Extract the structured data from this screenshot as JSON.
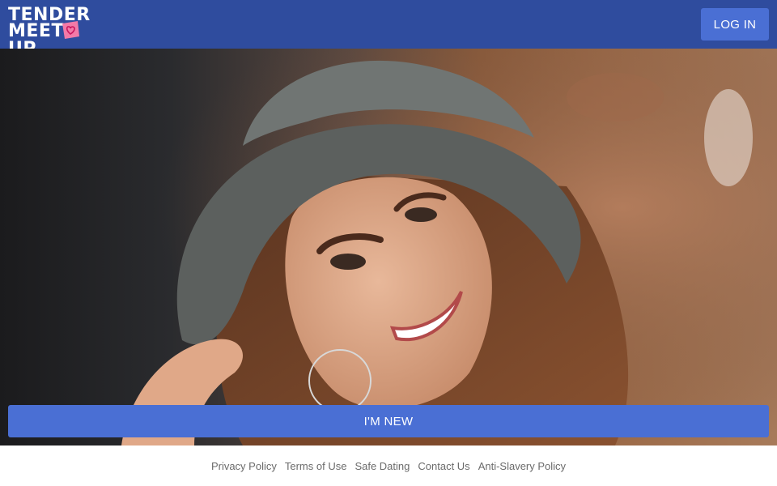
{
  "header": {
    "logo_text_line1": "TENDER",
    "logo_text_line2_left": "MEET",
    "logo_text_line2_right": "UP",
    "login_label": "LOG IN",
    "bg_color": "#2f4c9e",
    "button_color": "#4a6fd4"
  },
  "hero": {
    "new_label": "I'M NEW"
  },
  "footer": {
    "links": [
      {
        "label": "Privacy Policy"
      },
      {
        "label": "Terms of Use"
      },
      {
        "label": "Safe Dating"
      },
      {
        "label": "Contact Us"
      },
      {
        "label": "Anti-Slavery Policy"
      }
    ]
  }
}
